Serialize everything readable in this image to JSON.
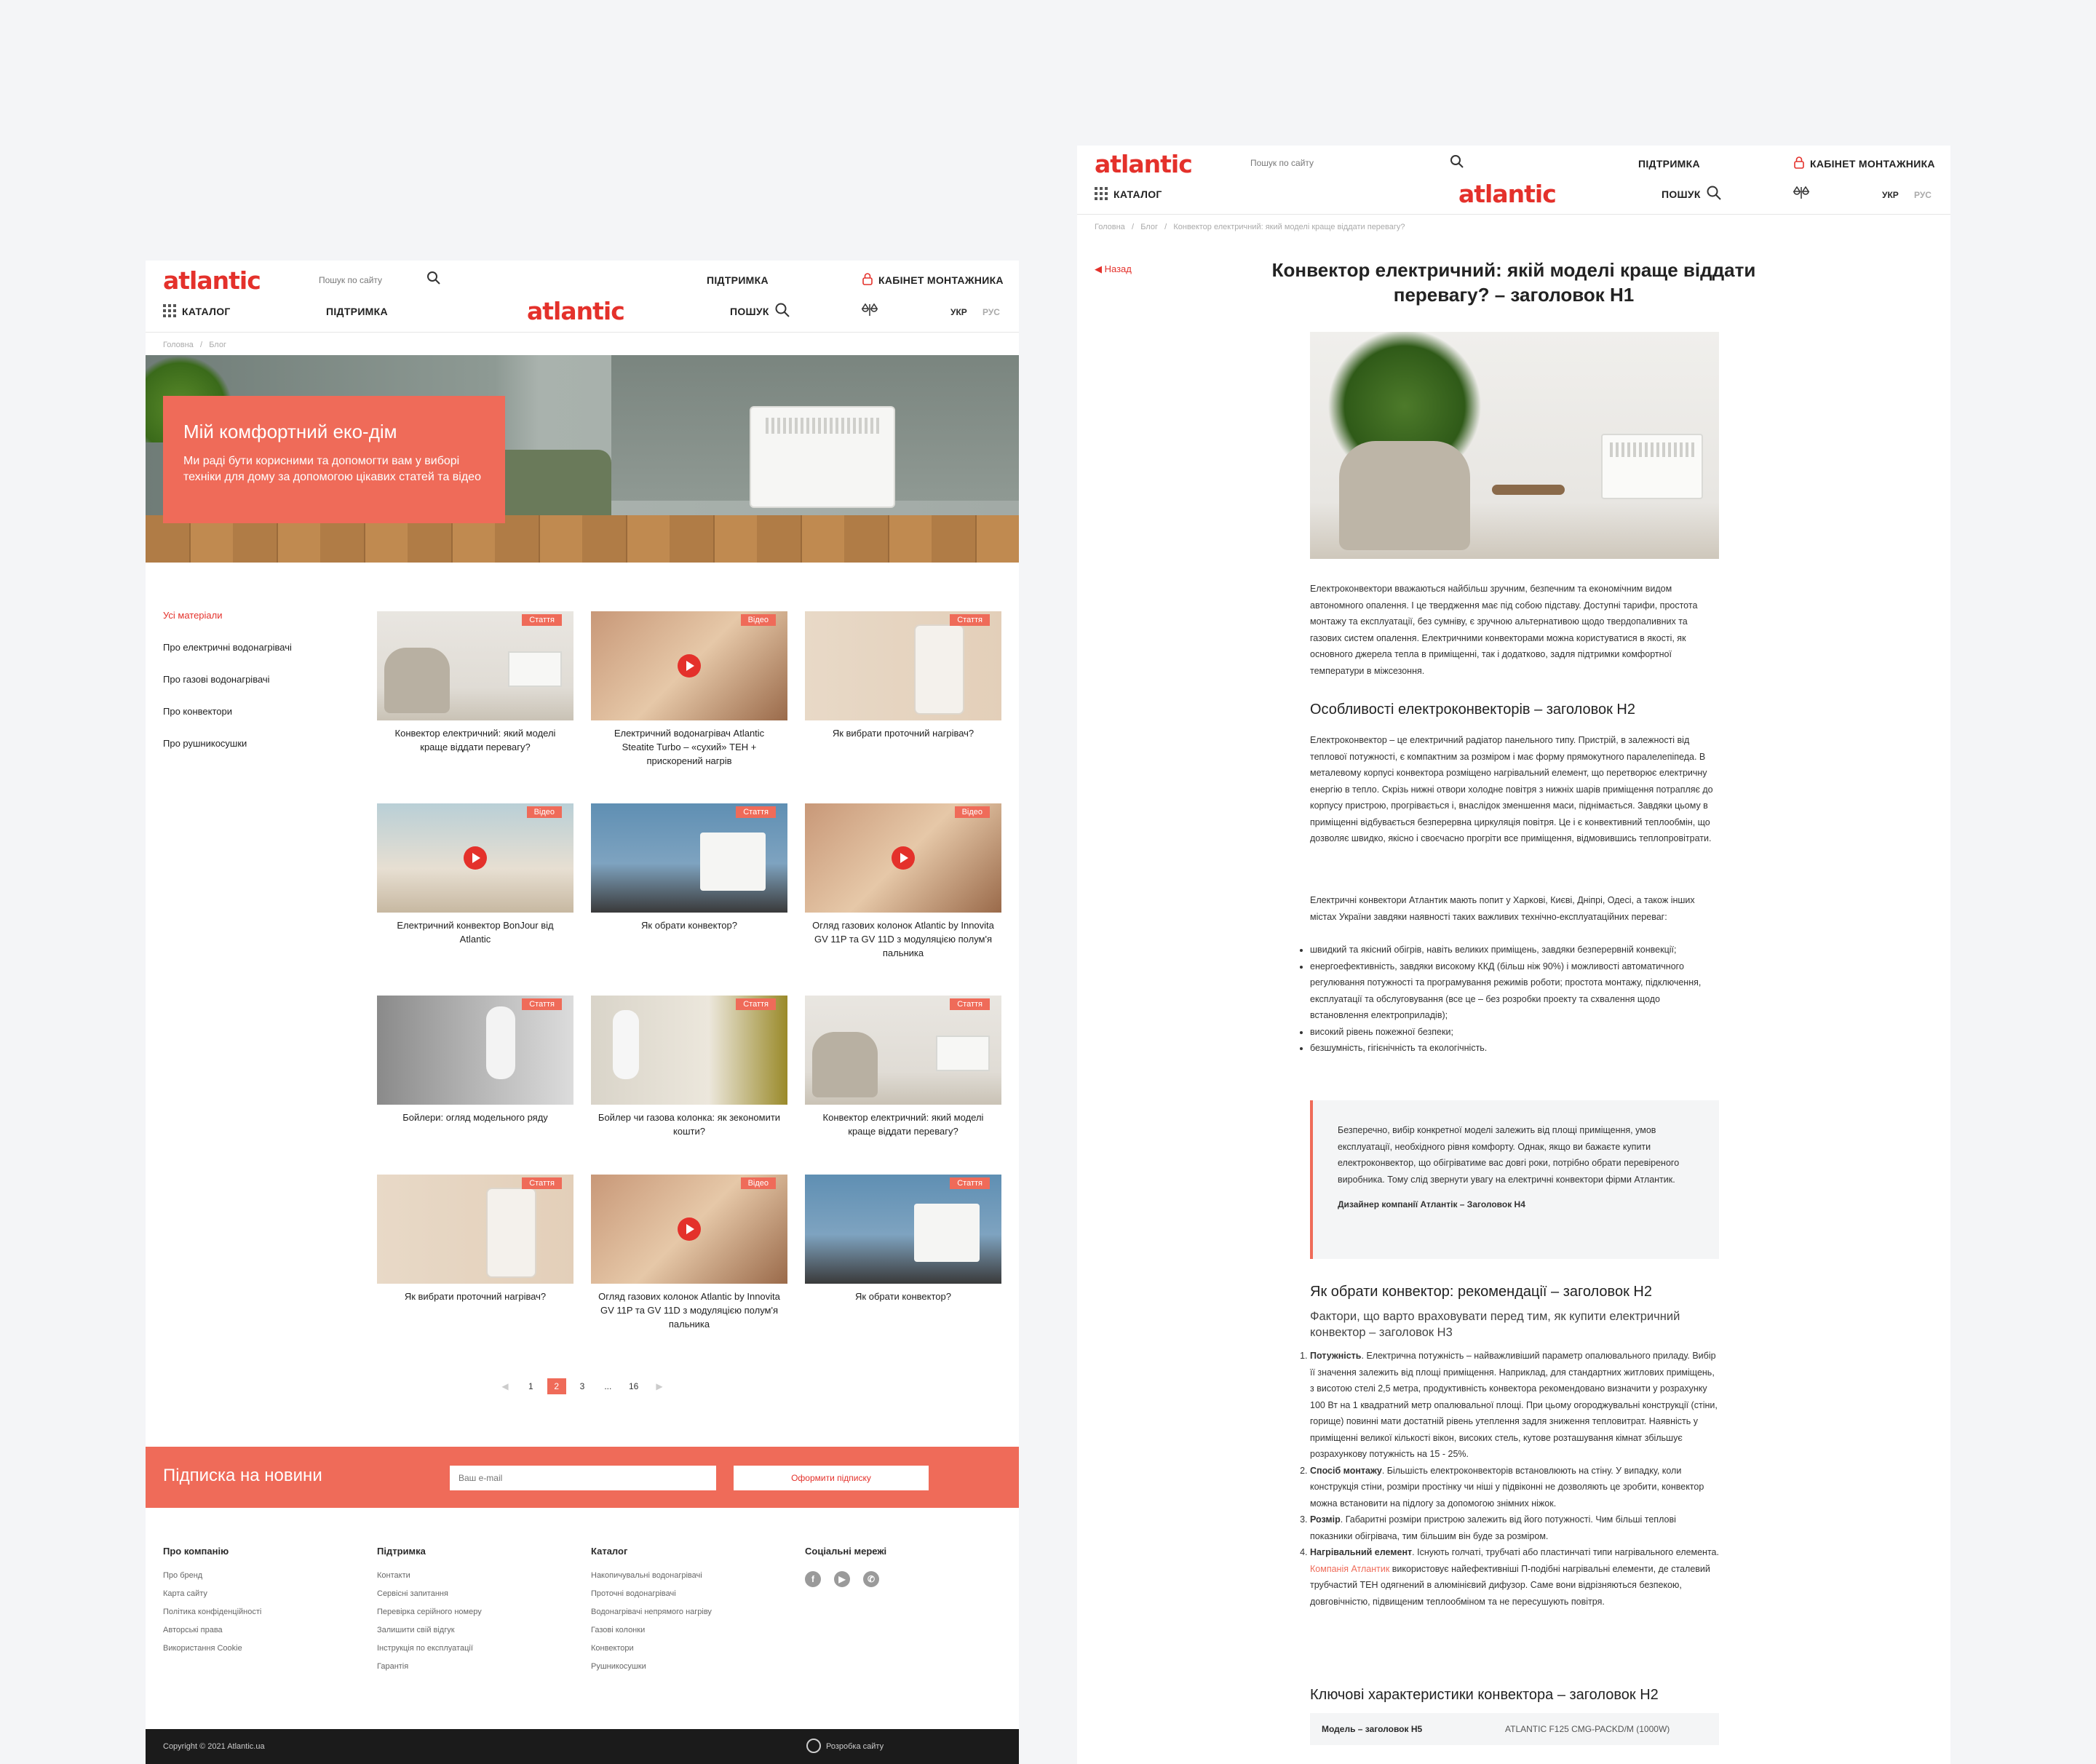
{
  "brand": {
    "logo": "atlantic",
    "accent": "#e4312b",
    "coral": "#ef6b59"
  },
  "header": {
    "search_placeholder": "Пошук по сайту",
    "support": "ПІДТРИМКА",
    "cabinet": "КАБІНЕТ МОНТАЖНИКА",
    "catalog": "КАТАЛОГ",
    "search": "ПОШУК",
    "lang_ukr": "УКР",
    "lang_rus": "РУС"
  },
  "blog": {
    "breadcrumbs": [
      "Головна",
      "Блог"
    ],
    "hero": {
      "title": "Мій комфортний еко-дім",
      "text": "Ми раді бути корисними та допомогти вам у виборі техніки для дому за допомогою цікавих статей та відео"
    },
    "sidebar": [
      "Усі матеріали",
      "Про електричні водонагрівачі",
      "Про газові водонагрівачі",
      "Про конвектори",
      "Про рушникосушки"
    ],
    "cards": [
      {
        "tag": "Стаття",
        "title": "Конвектор електричний: який моделі краще віддати перевагу?",
        "thumb": "living",
        "video": false
      },
      {
        "tag": "Відео",
        "title": "Електричний водонагрівач Atlantic Steatite Turbo – «сухий» ТЕН + прискорений нагрів",
        "thumb": "family",
        "video": true
      },
      {
        "tag": "Стаття",
        "title": "Як вибрати проточний нагрівач?",
        "thumb": "heater",
        "video": false
      },
      {
        "tag": "Відео",
        "title": "Електричний конвектор BonJour від Atlantic",
        "thumb": "kitchen",
        "video": true
      },
      {
        "tag": "Стаття",
        "title": "Як обрати конвектор?",
        "thumb": "blue",
        "video": false
      },
      {
        "tag": "Відео",
        "title": "Огляд газових колонок Atlantic by Innovita GV 11P та GV 11D з модуляцією полум'я пальника",
        "thumb": "family",
        "video": true
      },
      {
        "tag": "Стаття",
        "title": "Бойлери: огляд модельного ряду",
        "thumb": "bath",
        "video": false
      },
      {
        "tag": "Стаття",
        "title": "Бойлер чи газова колонка: як зекономити кошти?",
        "thumb": "bath2",
        "video": false
      },
      {
        "tag": "Стаття",
        "title": "Конвектор електричний: який моделі краще віддати перевагу?",
        "thumb": "living",
        "video": false
      },
      {
        "tag": "Стаття",
        "title": "Як вибрати проточний нагрівач?",
        "thumb": "heater",
        "video": false
      },
      {
        "tag": "Відео",
        "title": "Огляд газових колонок Atlantic by Innovita GV 11P та GV 11D з модуляцією полум'я пальника",
        "thumb": "family",
        "video": true
      },
      {
        "tag": "Стаття",
        "title": "Як обрати конвектор?",
        "thumb": "blue",
        "video": false
      }
    ],
    "pagination": {
      "pages": [
        "1",
        "2",
        "3",
        "...",
        "16"
      ],
      "current": "2"
    },
    "subscribe": {
      "title": "Підписка на новини",
      "placeholder": "Ваш e-mail",
      "button": "Оформити підписку"
    },
    "footer": {
      "company": {
        "title": "Про компанію",
        "links": [
          "Про бренд",
          "Карта сайту",
          "Політика конфіденційності",
          "Авторські права",
          "Використання Cookie"
        ]
      },
      "support": {
        "title": "Підтримка",
        "links": [
          "Контакти",
          "Сервісні запитання",
          "Перевірка серійного номеру",
          "Залишити свій відгук",
          "Інструкція по експлуатації",
          "Гарантія"
        ]
      },
      "catalog": {
        "title": "Каталог",
        "links": [
          "Накопичувальні водонагрівачі",
          "Проточні водонагрівачі",
          "Водонагрівачі непрямого нагріву",
          "Газові колонки",
          "Конвектори",
          "Рушникосушки"
        ]
      },
      "social": {
        "title": "Соціальні мережі",
        "icons": [
          "facebook-icon",
          "youtube-icon",
          "viber-icon"
        ]
      },
      "copyright": "Copyright © 2021 Atlantic.ua",
      "developer": "Розробка сайту"
    }
  },
  "article": {
    "breadcrumbs": [
      "Головна",
      "Блог",
      "Конвектор електричний: який моделі краще віддати перевагу?"
    ],
    "back": "Назад",
    "h1": "Конвектор електричний: якій моделі краще віддати перевагу? – заголовок H1",
    "intro": "Електроконвектори вважаються найбільш зручним, безпечним та економічним видом автономного опалення. І це твердження має під собою підставу. Доступні тарифи, простота монтажу та експлуатації, без сумніву, є зручною альтернативою щодо твердопаливних та газових систем опалення. Електричними конвекторами можна користуватися в якості, як основного джерела тепла в приміщенні, так і додатково, задля підтримки комфортної температури в міжсезоння.",
    "h2_1": "Особливості електроконвекторів – заголовок H2",
    "p2": "Електроконвектор – це електричний радіатор панельного типу. Пристрій, в залежності від теплової потужності, є компактним за розміром і має форму прямокутного паралелепіпеда. В металевому корпусі конвектора розміщено нагрівальний елемент, що перетворює електричну енергію в тепло. Скрізь нижні отвори холодне повітря з нижніх шарів приміщення потрапляє до корпусу пристрою, прогрівається і, внаслідок зменшення маси, піднімається. Завдяки цьому в приміщенні відбувається безперервна циркуляція повітря. Це і є конвективний теплообмін, що дозволяє швидко, якісно і своєчасно прогріти все приміщення, відмовившись теплопровітрати.",
    "p3": "Електричні конвектори Атлантик мають попит у Харкові, Києві, Дніпрі, Одесі, а також інших містах України завдяки наявності таких важливих технічно-експлуатаційних переваг:",
    "bullets": [
      "швидкий та якісний обігрів, навіть великих приміщень, завдяки безперервній конвекції;",
      "енергоефективність, завдяки високому ККД (більш ніж 90%) і можливості автоматичного регулювання потужності та програмування режимів роботи; простота монтажу, підключення, експлуатації та обслуговування (все це – без розробки проекту та схвалення щодо встановлення електроприладів);",
      "високий рівень пожежної безпеки;",
      "безшумність, гігієнічність та екологічність."
    ],
    "quote": "Безперечно, вибір конкретної моделі залежить від площі приміщення, умов експлуатації, необхідного рівня комфорту. Однак, якщо ви бажаєте купити електроконвектор, що обігріватиме вас довгі роки, потрібно обрати перевіреного виробника. Тому слід звернути увагу на електричні конвектори фірми Атлантик.",
    "quote_author": "Дизайнер компанії Атлантік – Заголовок H4",
    "h2_2": "Як обрати конвектор: рекомендації – заголовок H2",
    "h3": "Фактори, що варто враховувати перед тим, як купити електричний конвектор – заголовок H3",
    "list": [
      {
        "term": "Потужність",
        "text": ". Електрична потужність – найважливіший параметр опалювального приладу. Вибір її значення залежить від площі приміщення. Наприклад, для стандартних житлових приміщень, з висотою стелі 2,5 метра, продуктивність конвектора рекомендовано визначити у розрахунку 100 Вт на 1 квадратний метр опалювальної площі. При цьому огороджувальні конструкції (стіни, горище) повинні мати достатній рівень утеплення задля зниження тепловитрат. Наявність у приміщенні великої кількості вікон, високих стель, кутове розташування кімнат збільшує розрахункову потужність на 15 - 25%."
      },
      {
        "term": "Спосіб монтажу",
        "text": ". Більшість електроконвекторів встановлюють на стіну. У випадку, коли конструкція стіни, розміри простінку чи ніші у підвіконні не дозволяють це зробити, конвектор можна встановити на підлогу за допомогою знімних ніжок."
      },
      {
        "term": "Розмір",
        "text": ". Габаритні розміри пристрою залежить від його потужності. Чим більші теплові показники обігрівача, тим більшим він буде за розміром."
      },
      {
        "term": "Нагрівальний елемент",
        "text_before": ". Існують голчаті, трубчаті або пластинчаті типи нагрівального елемента. ",
        "link": "Компанія Атлантик",
        "text": " використовує найефективніші П-подібні нагрівальні елементи, де сталевий трубчастий ТЕН одягнений в алюмінієвий дифузор. Саме вони відрізняються безпекою, довговічністю, підвищеним теплообміном та не пересушують повітря."
      }
    ],
    "h2_3": "Ключові характеристики конвектора – заголовок H2",
    "table": {
      "label": "Модель – заголовок H5",
      "value": "ATLANTIC F125 CMG-PACKD/M (1000W)"
    }
  }
}
